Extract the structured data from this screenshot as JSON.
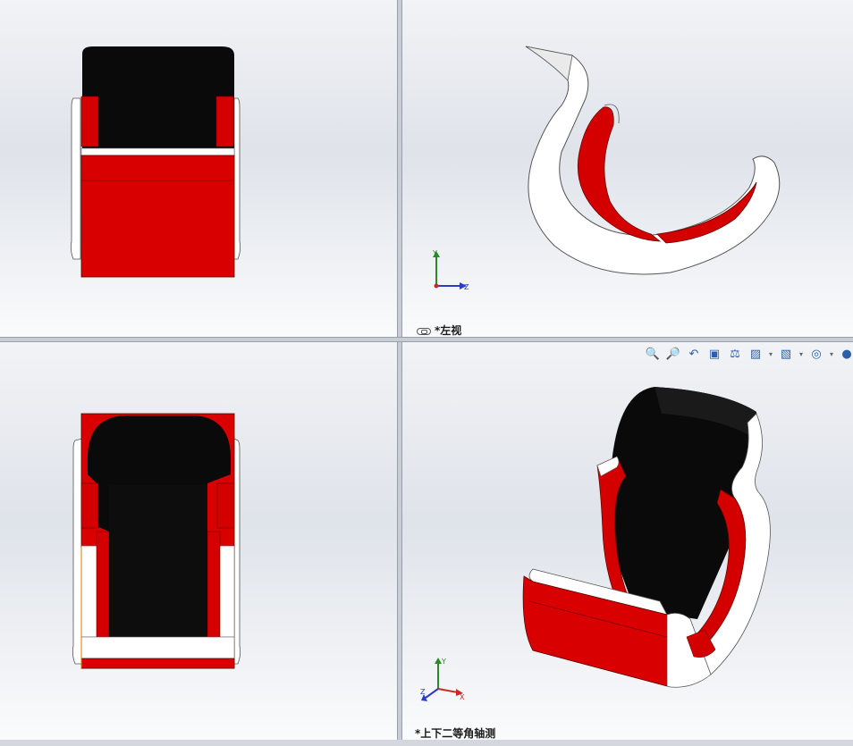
{
  "viewports": {
    "top_left": {
      "label": ""
    },
    "top_right": {
      "label": "*左视"
    },
    "bottom_left": {
      "label": ""
    },
    "bottom_right": {
      "label": "*上下二等角轴测"
    }
  },
  "triad": {
    "axis_y": "Y",
    "axis_z": "Z",
    "axis_x": "X"
  },
  "heads_up_toolbar": {
    "icons": [
      "zoom-to-fit-icon",
      "zoom-to-area-icon",
      "previous-view-icon",
      "section-view-icon",
      "dynamic-annotation-icon",
      "view-orientation-icon",
      "display-style-icon",
      "hide-show-icon",
      "edit-appearance-icon"
    ]
  },
  "colors": {
    "red": "#d40000",
    "black": "#0a0a0a",
    "white": "#ffffff",
    "accent_axis_y": "#2a8a2a",
    "accent_axis_z": "#2a3cc8",
    "accent_axis_x": "#c82a2a"
  }
}
